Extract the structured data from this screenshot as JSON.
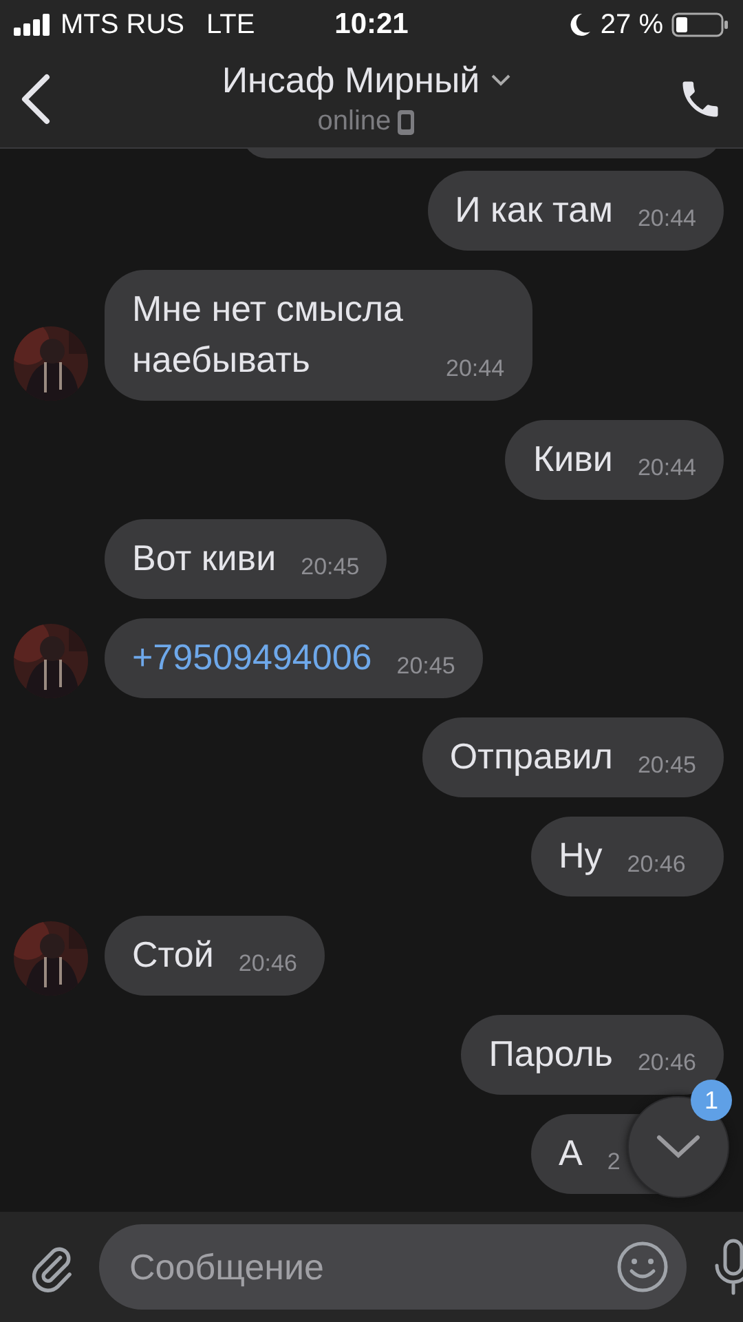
{
  "status_bar": {
    "carrier": "MTS RUS",
    "network": "LTE",
    "time": "10:21",
    "battery": "27 %"
  },
  "header": {
    "title": "Инсаф Мирный",
    "status": "online"
  },
  "messages": [
    {
      "kind": "out",
      "text": "И как там",
      "time": "20:44"
    },
    {
      "kind": "in",
      "text": "Мне нет смысла наебывать",
      "time": "20:44",
      "avatar": true
    },
    {
      "kind": "out",
      "text": "Киви",
      "time": "20:44"
    },
    {
      "kind": "in",
      "text": "Вот киви",
      "time": "20:45",
      "avatar": false
    },
    {
      "kind": "in",
      "link": "+79509494006",
      "time": "20:45",
      "avatar": true
    },
    {
      "kind": "out",
      "text": "Отправил",
      "time": "20:45"
    },
    {
      "kind": "out",
      "text": "Ну",
      "time": "20:46"
    },
    {
      "kind": "in",
      "text": "Стой",
      "time": "20:46",
      "avatar": true
    },
    {
      "kind": "out",
      "text": "Пароль",
      "time": "20:46"
    },
    {
      "kind": "out",
      "text": "А",
      "time": "2"
    }
  ],
  "scroll_button": {
    "badge": "1"
  },
  "composer": {
    "placeholder": "Сообщение"
  }
}
